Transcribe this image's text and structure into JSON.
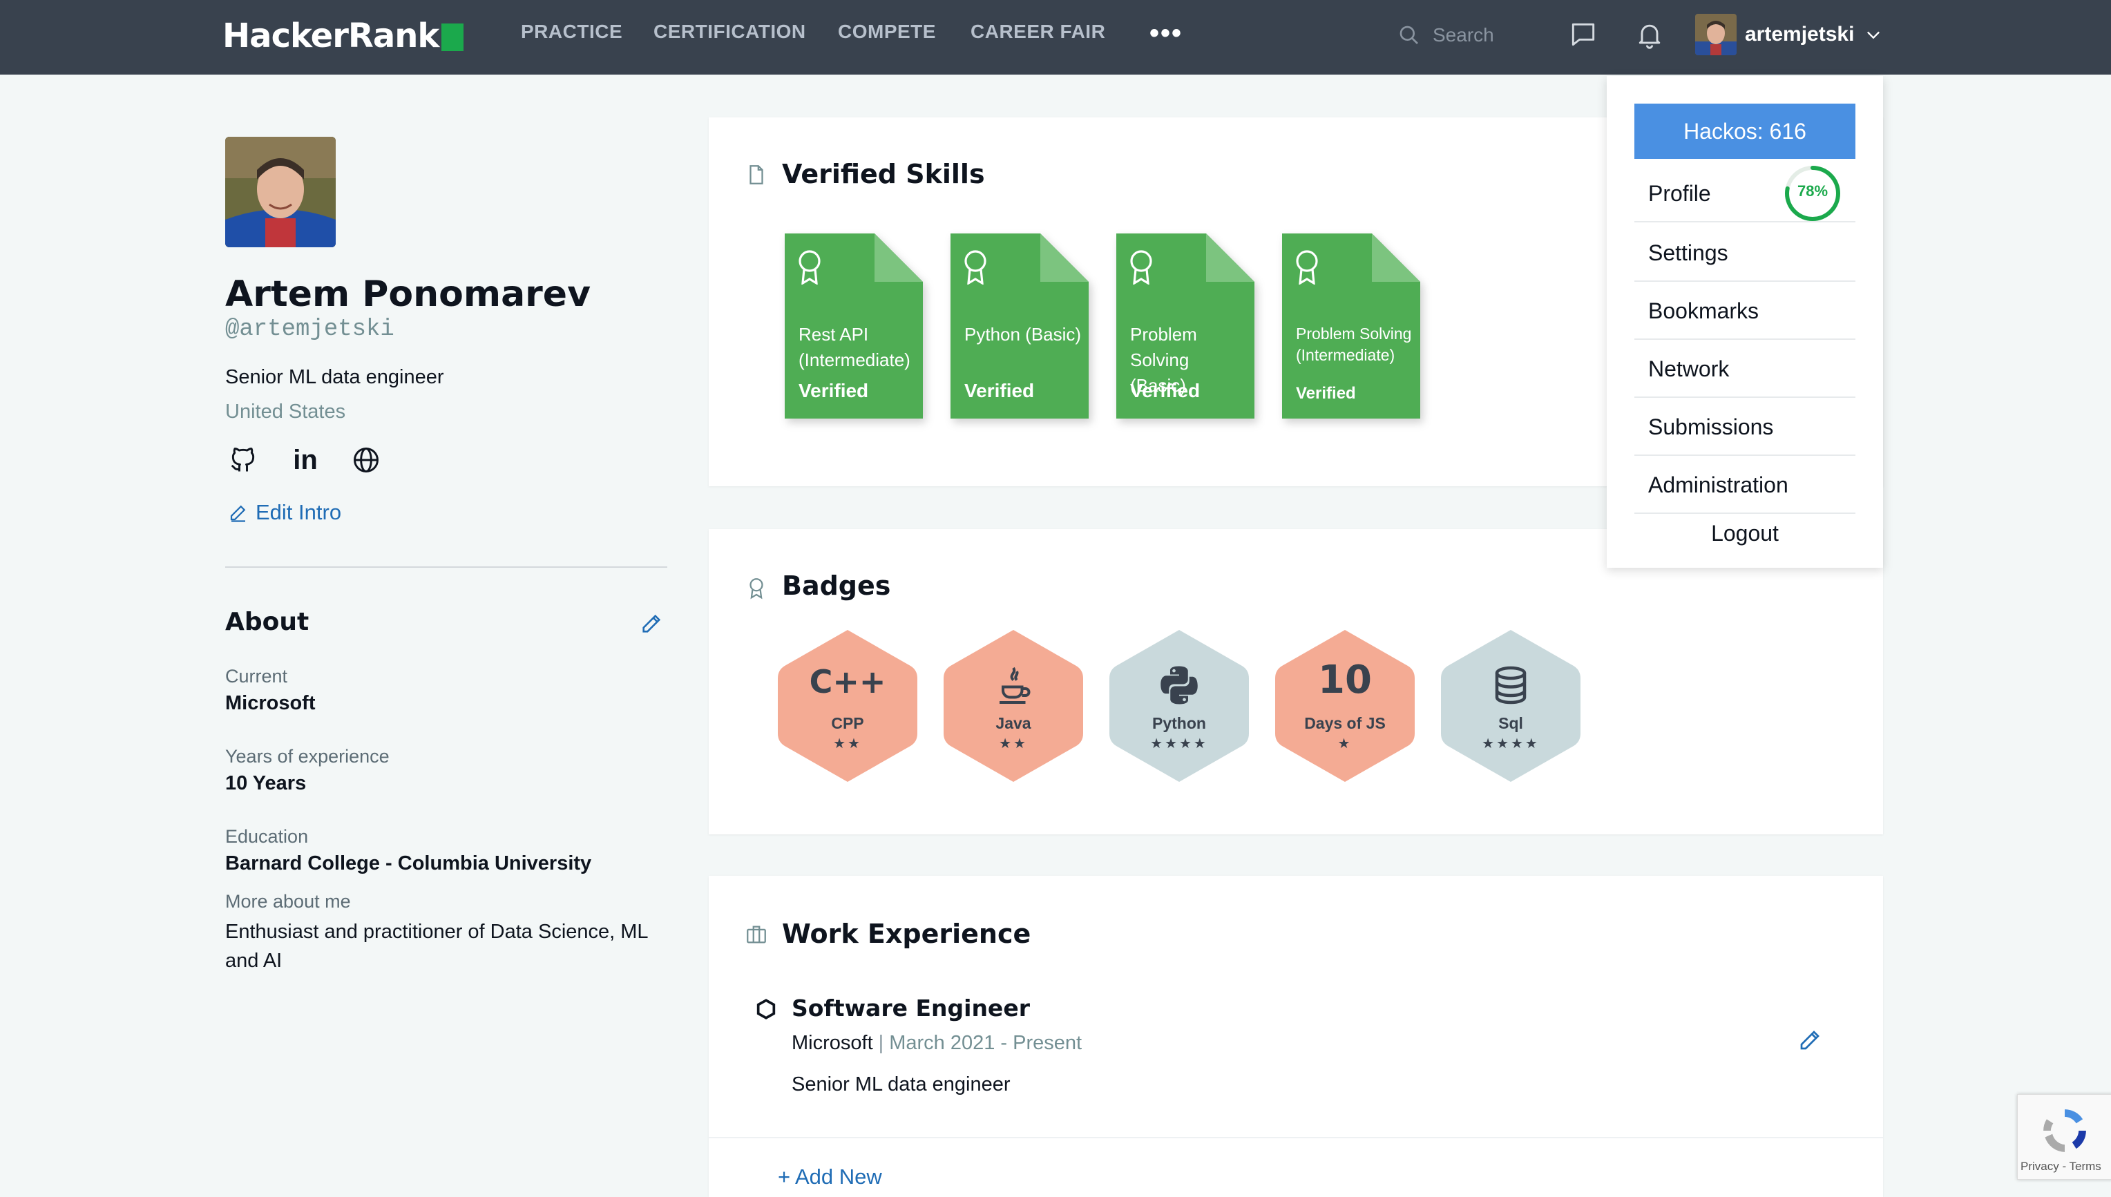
{
  "nav": {
    "logo": "HackerRank",
    "links": [
      "PRACTICE",
      "CERTIFICATION",
      "COMPETE",
      "CAREER FAIR"
    ],
    "more": "•••",
    "search_placeholder": "Search",
    "username": "artemjetski"
  },
  "profile": {
    "name": "Artem Ponomarev",
    "handle": "@artemjetski",
    "title": "Senior ML data engineer",
    "country": "United States",
    "edit_intro": "Edit Intro",
    "social": [
      "github-icon",
      "linkedin-icon",
      "globe-icon"
    ],
    "linkedin_glyph": "in"
  },
  "about": {
    "heading": "About",
    "current_label": "Current",
    "current_value": "Microsoft",
    "experience_label": "Years of experience",
    "experience_value": "10 Years",
    "education_label": "Education",
    "education_value": "Barnard College - Columbia University",
    "more_label": "More about me",
    "more_value": "Enthusiast and practitioner of Data Science, ML and AI"
  },
  "verified_skills": {
    "title": "Verified Skills",
    "certs": [
      {
        "name": "Rest API (Intermediate)",
        "status": "Verified"
      },
      {
        "name": "Python (Basic)",
        "status": "Verified"
      },
      {
        "name": "Problem Solving (Basic)",
        "status": "Verified"
      },
      {
        "name": "Problem Solving (Intermediate)",
        "status": "Verified"
      }
    ],
    "cert_color": "#4fad54"
  },
  "badges": {
    "title": "Badges",
    "items": [
      {
        "name": "CPP",
        "stars": "★★",
        "glyph": "C++",
        "icon": "cpp-icon",
        "color": "#f4ab94"
      },
      {
        "name": "Java",
        "stars": "★★",
        "glyph": "",
        "icon": "java-icon",
        "color": "#f4ab94"
      },
      {
        "name": "Python",
        "stars": "★★★★",
        "glyph": "",
        "icon": "python-icon",
        "color": "#c9d9dc"
      },
      {
        "name": "Days of JS",
        "stars": "★",
        "glyph": "10",
        "icon": "days-of-js-icon",
        "color": "#f4ab94"
      },
      {
        "name": "Sql",
        "stars": "★★★★",
        "glyph": "",
        "icon": "database-icon",
        "color": "#c9d9dc"
      }
    ]
  },
  "work": {
    "title": "Work Experience",
    "role": "Software Engineer",
    "company": "Microsoft",
    "separator": "|",
    "dates": "March 2021 - Present",
    "description": "Senior ML data engineer",
    "add_new": "+ Add New"
  },
  "dropdown": {
    "hackos": "Hackos: 616",
    "profile": "Profile",
    "profile_progress": 0.78,
    "profile_progress_label": "78%",
    "items": [
      "Settings",
      "Bookmarks",
      "Network",
      "Submissions",
      "Administration"
    ],
    "logout": "Logout"
  },
  "recaptcha": {
    "links": "Privacy - Terms"
  },
  "colors": {
    "nav_bg": "#39424e",
    "accent_green": "#1ba94c",
    "link_blue": "#1f6cb5",
    "hackos_blue": "#4a90e2"
  }
}
